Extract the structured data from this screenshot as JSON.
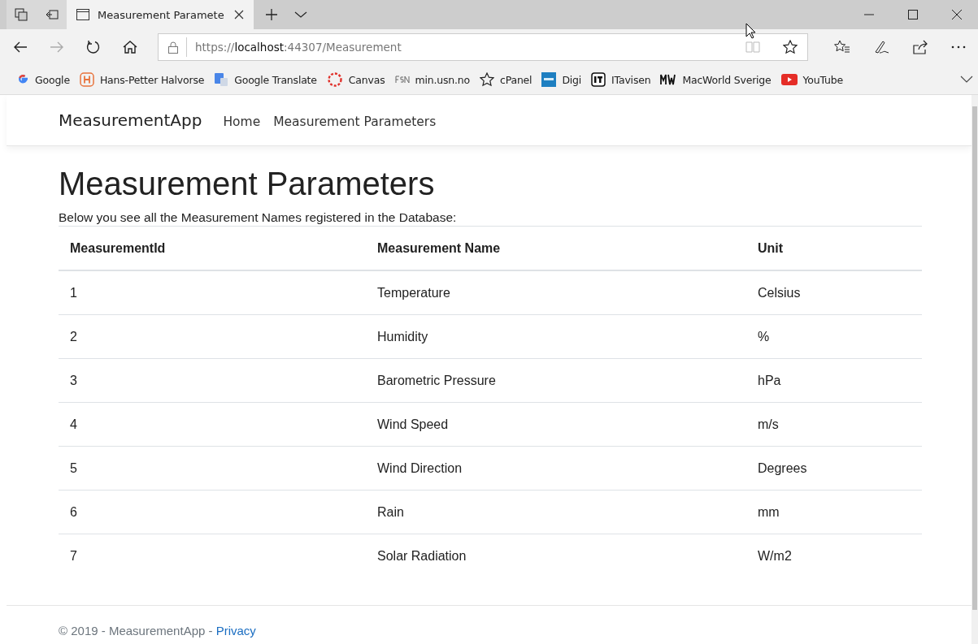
{
  "browser": {
    "tabs": [
      {
        "title": "Measurement Paramete",
        "selected": true
      }
    ],
    "address": {
      "scheme": "https://",
      "host": "localhost",
      "rest": ":44307/Measurement"
    },
    "bookmarks": [
      {
        "label": "Google",
        "kind": "google"
      },
      {
        "label": "Hans-Petter Halvorse",
        "kind": "letter"
      },
      {
        "label": "Google Translate",
        "kind": "translate"
      },
      {
        "label": "Canvas",
        "kind": "ring"
      },
      {
        "label": "min.usn.no",
        "kind": "usn"
      },
      {
        "label": "cPanel",
        "kind": "star"
      },
      {
        "label": "Digi",
        "kind": "digi"
      },
      {
        "label": "ITavisen",
        "kind": "it"
      },
      {
        "label": "MacWorld Sverige",
        "kind": "mw"
      },
      {
        "label": "YouTube",
        "kind": "play"
      }
    ]
  },
  "navbar": {
    "brand": "MeasurementApp",
    "links": [
      "Home",
      "Measurement Parameters"
    ]
  },
  "page": {
    "title": "Measurement Parameters",
    "intro": "Below you see all the Measurement Names registered in the Database:"
  },
  "table": {
    "columns": [
      "MeasurementId",
      "Measurement Name",
      "Unit"
    ],
    "rows": [
      [
        "1",
        "Temperature",
        "Celsius"
      ],
      [
        "2",
        "Humidity",
        "%"
      ],
      [
        "3",
        "Barometric Pressure",
        "hPa"
      ],
      [
        "4",
        "Wind Speed",
        "m/s"
      ],
      [
        "5",
        "Wind Direction",
        "Degrees"
      ],
      [
        "6",
        "Rain",
        "mm"
      ],
      [
        "7",
        "Solar Radiation",
        "W/m2"
      ]
    ]
  },
  "footer": {
    "text": "© 2019 - MeasurementApp - ",
    "link": "Privacy"
  }
}
